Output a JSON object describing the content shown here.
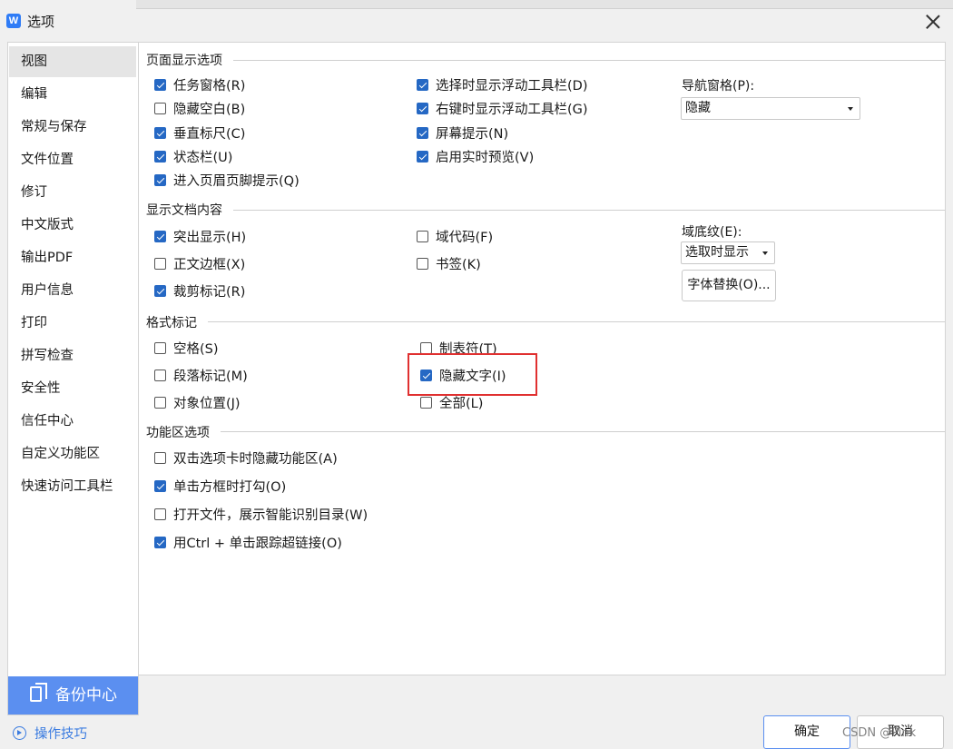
{
  "window": {
    "title": "选项",
    "app_icon_letter": "W"
  },
  "sidebar": {
    "items": [
      {
        "label": "视图",
        "selected": true
      },
      {
        "label": "编辑"
      },
      {
        "label": "常规与保存"
      },
      {
        "label": "文件位置"
      },
      {
        "label": "修订"
      },
      {
        "label": "中文版式"
      },
      {
        "label": "输出PDF"
      },
      {
        "label": "用户信息"
      },
      {
        "label": "打印"
      },
      {
        "label": "拼写检查"
      },
      {
        "label": "安全性"
      },
      {
        "label": "信任中心"
      },
      {
        "label": "自定义功能区"
      },
      {
        "label": "快速访问工具栏"
      }
    ],
    "backup_label": "备份中心"
  },
  "sections": {
    "page_display": {
      "title": "页面显示选项",
      "checkboxes": [
        {
          "label": "任务窗格(R)",
          "checked": true
        },
        {
          "label": "隐藏空白(B)",
          "checked": false
        },
        {
          "label": "垂直标尺(C)",
          "checked": true
        },
        {
          "label": "状态栏(U)",
          "checked": true
        },
        {
          "label": "进入页眉页脚提示(Q)",
          "checked": true
        },
        {
          "label": "选择时显示浮动工具栏(D)",
          "checked": true
        },
        {
          "label": "右键时显示浮动工具栏(G)",
          "checked": true
        },
        {
          "label": "屏幕提示(N)",
          "checked": true
        },
        {
          "label": "启用实时预览(V)",
          "checked": true
        }
      ],
      "nav_pane_label": "导航窗格(P):",
      "nav_pane_value": "隐藏"
    },
    "doc_content": {
      "title": "显示文档内容",
      "checkboxes": [
        {
          "label": "突出显示(H)",
          "checked": true
        },
        {
          "label": "正文边框(X)",
          "checked": false
        },
        {
          "label": "裁剪标记(R)",
          "checked": true
        },
        {
          "label": "域代码(F)",
          "checked": false
        },
        {
          "label": "书签(K)",
          "checked": false
        }
      ],
      "field_shading_label": "域底纹(E):",
      "field_shading_value": "选取时显示",
      "font_sub_button": "字体替换(O)..."
    },
    "format_marks": {
      "title": "格式标记",
      "checkboxes": [
        {
          "label": "空格(S)",
          "checked": false
        },
        {
          "label": "段落标记(M)",
          "checked": false
        },
        {
          "label": "对象位置(J)",
          "checked": false
        },
        {
          "label": "制表符(T)",
          "checked": false
        },
        {
          "label": "隐藏文字(I)",
          "checked": true
        },
        {
          "label": "全部(L)",
          "checked": false
        }
      ]
    },
    "ribbon": {
      "title": "功能区选项",
      "checkboxes": [
        {
          "label": "双击选项卡时隐藏功能区(A)",
          "checked": false
        },
        {
          "label": "单击方框时打勾(O)",
          "checked": true
        },
        {
          "label": "打开文件，展示智能识别目录(W)",
          "checked": false
        },
        {
          "label": "用Ctrl + 单击跟踪超链接(O)",
          "checked": true
        }
      ]
    }
  },
  "footer": {
    "tips_label": "操作技巧",
    "ok_label": "确定",
    "cancel_label": "取消",
    "watermark": "CSDN @Pink"
  }
}
